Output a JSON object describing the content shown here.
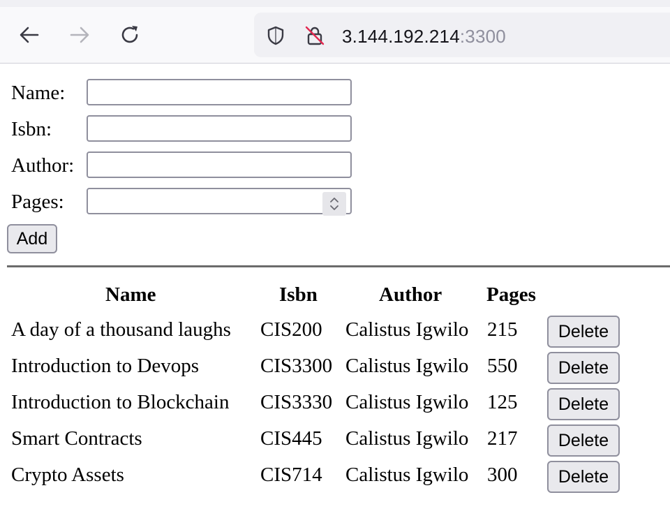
{
  "browser": {
    "url_host": "3.144.192.214",
    "url_port": ":3300",
    "icons": [
      "back-arrow-icon",
      "forward-arrow-icon",
      "reload-icon",
      "shield-icon",
      "insecure-lock-icon"
    ]
  },
  "form": {
    "name_label": "Name:",
    "isbn_label": "Isbn:",
    "author_label": "Author:",
    "pages_label": "Pages:",
    "name_value": "",
    "isbn_value": "",
    "author_value": "",
    "pages_value": "",
    "add_label": "Add"
  },
  "table": {
    "headers": [
      "Name",
      "Isbn",
      "Author",
      "Pages"
    ],
    "delete_label": "Delete",
    "rows": [
      {
        "name": "A day of a thousand laughs",
        "isbn": "CIS200",
        "author": "Calistus Igwilo",
        "pages": "215"
      },
      {
        "name": "Introduction to Devops",
        "isbn": "CIS3300",
        "author": "Calistus Igwilo",
        "pages": "550"
      },
      {
        "name": "Introduction to Blockchain",
        "isbn": "CIS3330",
        "author": "Calistus Igwilo",
        "pages": "125"
      },
      {
        "name": "Smart Contracts",
        "isbn": "CIS445",
        "author": "Calistus Igwilo",
        "pages": "217"
      },
      {
        "name": "Crypto Assets",
        "isbn": "CIS714",
        "author": "Calistus Igwilo",
        "pages": "300"
      }
    ]
  }
}
